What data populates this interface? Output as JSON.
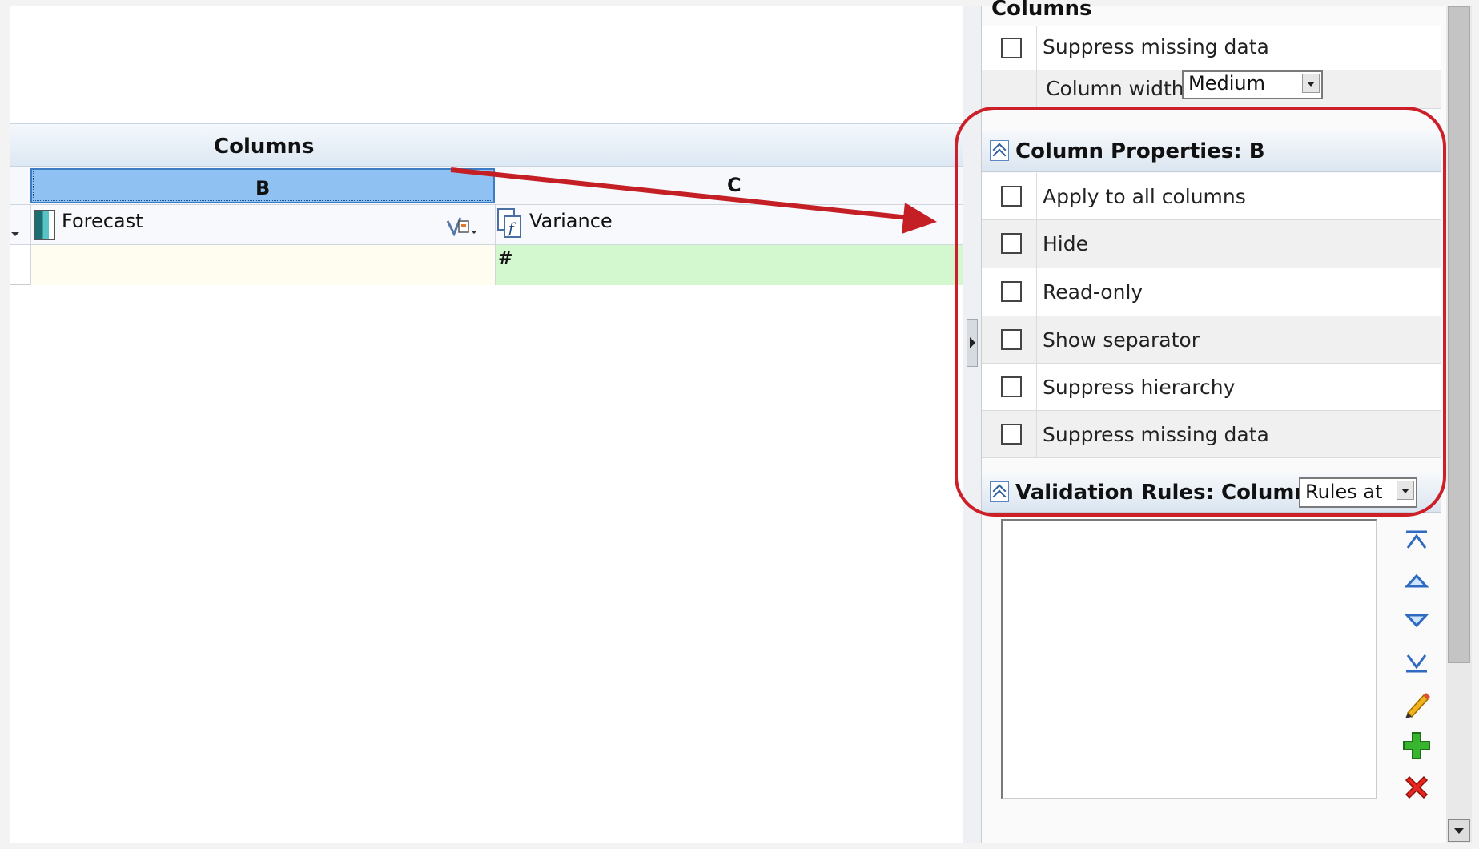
{
  "grid": {
    "section_title": "Columns",
    "columns": [
      {
        "letter": "B",
        "member": "Forecast",
        "cell": ""
      },
      {
        "letter": "C",
        "member": "Variance",
        "cell": "#"
      }
    ]
  },
  "panel": {
    "top_heading": "Columns",
    "top_rows": [
      {
        "label": "Suppress missing data",
        "checked": false
      },
      {
        "label": "Column width",
        "value": "Medium"
      }
    ],
    "column_properties": {
      "title": "Column Properties: B",
      "options": [
        {
          "label": "Apply to all columns",
          "checked": false
        },
        {
          "label": "Hide",
          "checked": false
        },
        {
          "label": "Read-only",
          "checked": false
        },
        {
          "label": "Show separator",
          "checked": false
        },
        {
          "label": "Suppress hierarchy",
          "checked": false
        },
        {
          "label": "Suppress missing data",
          "checked": false
        }
      ]
    },
    "validation_rules": {
      "title": "Validation Rules: Column B",
      "selector_value": "Rules at"
    },
    "toolbar": [
      "move-top-icon",
      "move-up-icon",
      "move-down-icon",
      "move-bottom-icon",
      "edit-pencil-icon",
      "add-plus-icon",
      "delete-x-icon"
    ]
  },
  "colors": {
    "highlight_outline": "#cc1f27",
    "arrow": "#c41f25",
    "selected_column": "#8fc1f3",
    "data_cell_green": "#d3f7ce"
  }
}
